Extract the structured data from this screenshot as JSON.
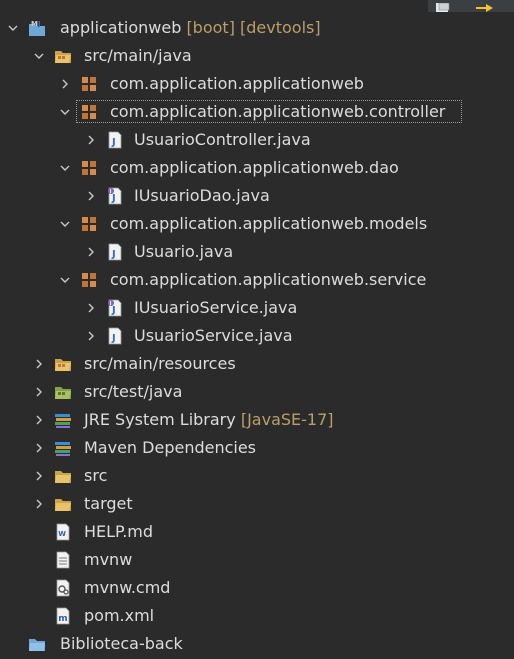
{
  "toolbar": {
    "collapse_all_icon": "collapse-all-icon",
    "link_with_editor_icon": "link-with-editor-icon"
  },
  "colors": {
    "background": "#2b2b2b",
    "text": "#dddddd",
    "decoration": "#b99f6a",
    "package_icon": "#c0763a",
    "java_icon": "#4f8fdc",
    "interface_icon": "#8a6fd6"
  },
  "tree": {
    "project": {
      "name": "applicationweb",
      "decorations": "[boot] [devtools]"
    },
    "src_main_java": "src/main/java",
    "pkg_root": "com.application.applicationweb",
    "pkg_controller": "com.application.applicationweb.controller",
    "file_usuario_controller": "UsuarioController.java",
    "pkg_dao": "com.application.applicationweb.dao",
    "file_iusuario_dao": "IUsuarioDao.java",
    "pkg_models": "com.application.applicationweb.models",
    "file_usuario": "Usuario.java",
    "pkg_service": "com.application.applicationweb.service",
    "file_iusuario_service": "IUsuarioService.java",
    "file_usuario_service": "UsuarioService.java",
    "src_main_resources": "src/main/resources",
    "src_test_java": "src/test/java",
    "jre": {
      "name": "JRE System Library",
      "decoration": "[JavaSE-17]"
    },
    "maven_dependencies": "Maven Dependencies",
    "folder_src": "src",
    "folder_target": "target",
    "file_help": "HELP.md",
    "file_mvnw": "mvnw",
    "file_mvnw_cmd": "mvnw.cmd",
    "file_pom": "pom.xml",
    "project_biblioteca": "Biblioteca-back"
  }
}
